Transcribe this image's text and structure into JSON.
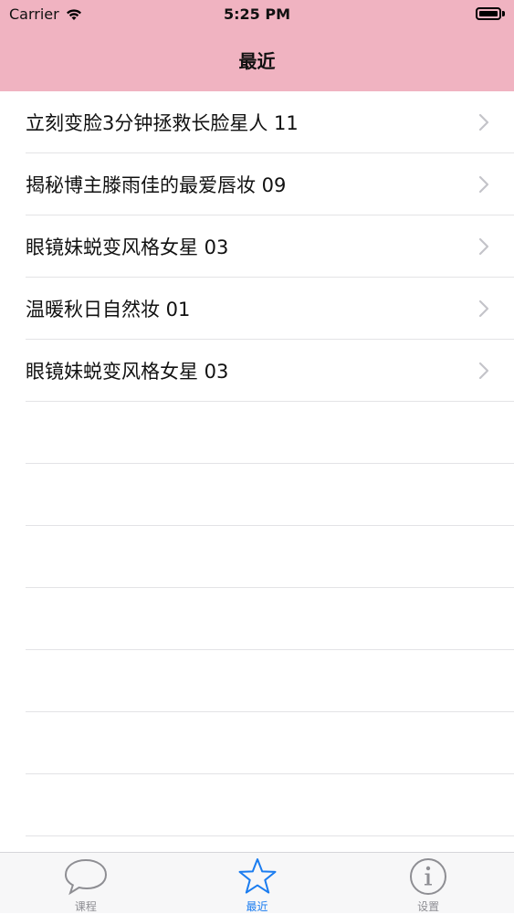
{
  "status_bar": {
    "carrier": "Carrier",
    "time": "5:25 PM"
  },
  "nav": {
    "title": "最近"
  },
  "list": {
    "items": [
      {
        "label": "立刻变脸3分钟拯救长脸星人 11"
      },
      {
        "label": "揭秘博主滕雨佳的最爱唇妆 09"
      },
      {
        "label": "眼镜妹蜕变风格女星 03"
      },
      {
        "label": "温暖秋日自然妆 01"
      },
      {
        "label": "眼镜妹蜕变风格女星 03"
      }
    ]
  },
  "tabs": [
    {
      "label": "课程",
      "icon": "speech-bubble-icon",
      "active": false
    },
    {
      "label": "最近",
      "icon": "star-icon",
      "active": true
    },
    {
      "label": "设置",
      "icon": "info-icon",
      "active": false
    }
  ],
  "colors": {
    "header": "#f0b3c1",
    "active_tab": "#1a7cf0",
    "inactive_tab": "#8e8e93"
  }
}
